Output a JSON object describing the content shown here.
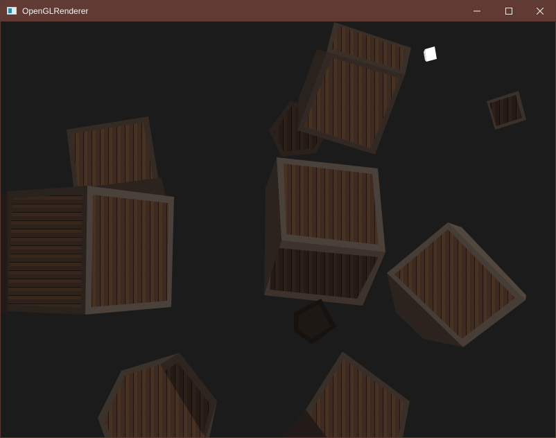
{
  "window": {
    "title": "OpenGLRenderer",
    "icon": "app-window-icon",
    "controls": {
      "minimize": "minimize-icon",
      "maximize": "maximize-icon",
      "close": "close-icon"
    }
  },
  "scene": {
    "background_color": "#1b1b1b",
    "crate_wood_color": "#4a3326",
    "crate_frame_color": "#3b3430",
    "light_source_color": "#ffffff",
    "titlebar_color": "#613a34"
  }
}
